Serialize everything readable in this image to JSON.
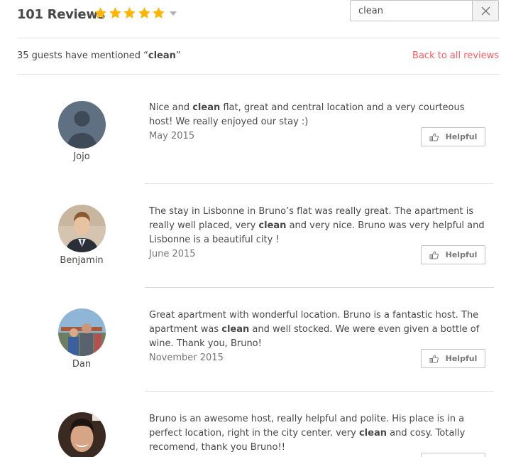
{
  "header": {
    "title": "101 Reviews",
    "rating": 5,
    "star_color": "#ffb400",
    "icons": [
      "star-icon",
      "caret-down-icon"
    ]
  },
  "search": {
    "value": "clean",
    "clear_icon": "close-icon"
  },
  "filter": {
    "mention_prefix": "35 guests have mentioned “",
    "keyword": "clean",
    "mention_suffix": "”",
    "back_label": "Back to all reviews",
    "back_color": "#ff5a5f"
  },
  "reviews": [
    {
      "name": "Jojo",
      "text_parts": [
        "Nice and ",
        "clean",
        " flat, great and central location and a very courteous host! We really enjoyed our stay :)"
      ],
      "date": "May 2015",
      "helpful_label": "Helpful"
    },
    {
      "name": "Benjamin",
      "text_parts": [
        "The stay in Lisbonne in Bruno’s flat was really great. The apartment is really well placed, very ",
        "clean",
        " and very nice. Bruno was very helpful and Lisbonne is a beautiful city !"
      ],
      "date": "June 2015",
      "helpful_label": "Helpful"
    },
    {
      "name": "Dan",
      "text_parts": [
        "Great apartment with wonderful location. Bruno is a fantastic host. The apartment was ",
        "clean",
        " and well stocked. We were even given a bottle of wine. Thank you, Bruno!"
      ],
      "date": "November 2015",
      "helpful_label": "Helpful"
    },
    {
      "text_parts": [
        "Bruno is an awesome host, really helpful and polite. His place is in a perfect location, right in the city center. very ",
        "clean",
        " and cosy. Totally recomend, thank you Bruno!!"
      ]
    }
  ]
}
